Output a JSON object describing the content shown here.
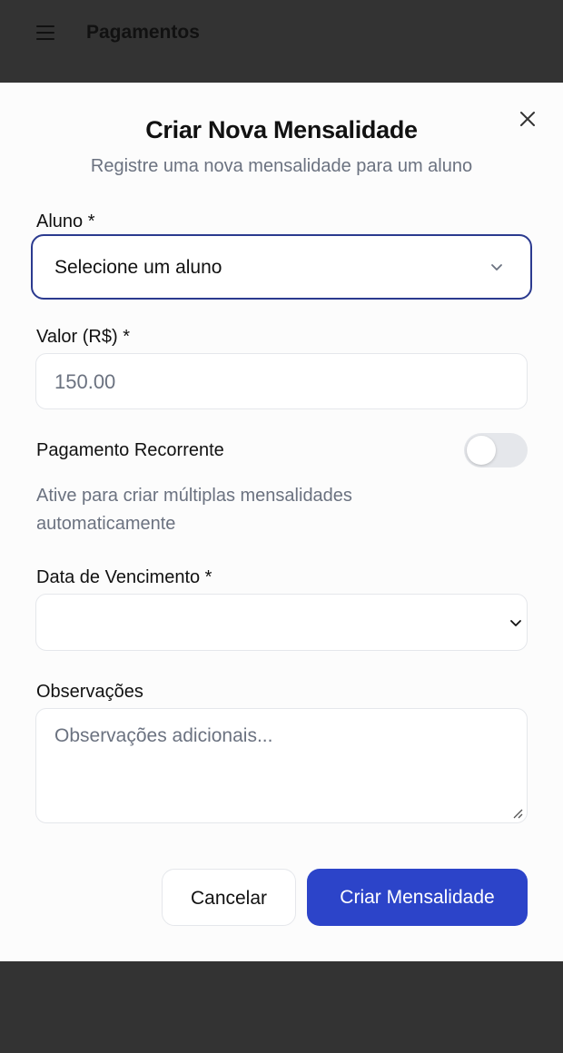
{
  "header": {
    "title": "Pagamentos"
  },
  "dialog": {
    "title": "Criar Nova Mensalidade",
    "subtitle": "Registre uma nova mensalidade para um aluno",
    "aluno": {
      "label": "Aluno *",
      "selected": "Selecione um aluno"
    },
    "valor": {
      "label": "Valor (R$) *",
      "value": "150.00"
    },
    "recorrente": {
      "label": "Pagamento Recorrente",
      "enabled": false,
      "help": "Ative para criar múltiplas mensalidades automaticamente"
    },
    "vencimento": {
      "label": "Data de Vencimento *",
      "value": ""
    },
    "observacoes": {
      "label": "Observações",
      "placeholder": "Observações adicionais..."
    },
    "buttons": {
      "cancel": "Cancelar",
      "submit": "Criar Mensalidade"
    }
  },
  "colors": {
    "primary": "#2c44c9",
    "focus_border": "#2b3a8f",
    "muted_text": "#6b7280",
    "overlay": "#333333"
  }
}
